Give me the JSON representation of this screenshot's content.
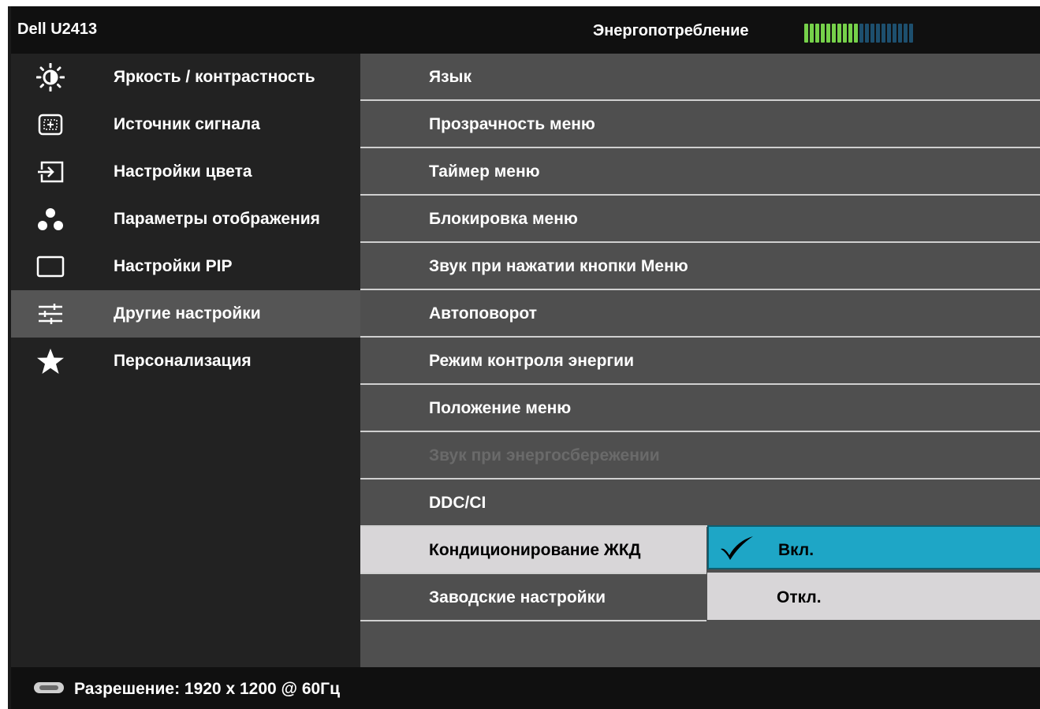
{
  "header": {
    "model": "Dell U2413",
    "energy_label": "Энергопотребление",
    "energy_meter": {
      "total_segments": 20,
      "filled_segments": 10,
      "filled_color": "#76d14a",
      "empty_color": "#1d4f6e"
    }
  },
  "left_menu": {
    "items": [
      {
        "label": "Яркость / контрастность",
        "icon": "brightness-icon"
      },
      {
        "label": "Источник сигнала",
        "icon": "input-source-icon"
      },
      {
        "label": "Настройки цвета",
        "icon": "color-settings-icon"
      },
      {
        "label": "Параметры отображения",
        "icon": "display-settings-icon"
      },
      {
        "label": "Настройки PIP",
        "icon": "pip-icon"
      },
      {
        "label": "Другие настройки",
        "icon": "other-settings-icon",
        "active": true
      },
      {
        "label": "Персонализация",
        "icon": "star-icon"
      }
    ]
  },
  "right_menu": {
    "items": [
      {
        "label": "Язык"
      },
      {
        "label": "Прозрачность меню"
      },
      {
        "label": "Таймер меню"
      },
      {
        "label": "Блокировка меню"
      },
      {
        "label": "Звук при нажатии кнопки Меню"
      },
      {
        "label": "Автоповорот"
      },
      {
        "label": "Режим контроля энергии"
      },
      {
        "label": "Положение меню"
      },
      {
        "label": "Звук при энергосбережении",
        "disabled": true
      },
      {
        "label": "DDC/CI"
      },
      {
        "label": "Кондиционирование ЖКД",
        "selected": true
      },
      {
        "label": "Заводские настройки"
      }
    ]
  },
  "submenu": {
    "on_label": "Вкл.",
    "off_label": "Откл.",
    "checked": "on",
    "highlight_color": "#1ea6c6"
  },
  "status": {
    "resolution_text": "Разрешение: 1920 x 1200 @ 60Гц",
    "icon": "display-connector-icon"
  }
}
